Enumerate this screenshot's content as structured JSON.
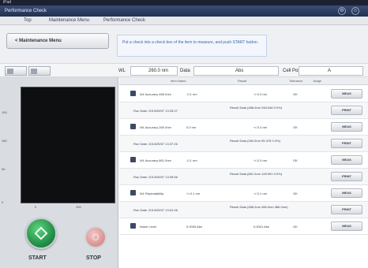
{
  "statusbar": {
    "carrier": "iPad",
    "time": "",
    "battery": ""
  },
  "titlebar": {
    "title": "Performance Check"
  },
  "tabs": [
    "Top",
    "Maintenance Menu",
    "Performance Check"
  ],
  "nav": {
    "back_label": "< Maintenance Menu",
    "instruction": "Put a check into a check box of the item to measure, and push START button."
  },
  "controls": {
    "wl_label": "WL",
    "wl_value": "260.0 nm",
    "data_label": "Data",
    "data_value": "Abs",
    "cell_label": "Cell Pos.",
    "cell_value": "A"
  },
  "plot": {
    "y_ticks": [
      "100",
      "150",
      "50",
      "0"
    ],
    "x_ticks": [
      "0",
      "100"
    ]
  },
  "actions": {
    "start": "START",
    "stop": "STOP"
  },
  "table": {
    "headers": [
      "Item Name",
      "Result",
      "Tolerance",
      "Judge"
    ],
    "measure_label": "MEAS",
    "print_label": "PRINT",
    "rows": [
      {
        "type": "item",
        "name": "WL Accuracy 486.0nm",
        "result": "-0.1 nm",
        "tolerance": "+/-0.3 nm",
        "judge": "OK"
      },
      {
        "type": "run",
        "date": "Run Date: 2013/05/07 13:33:07",
        "result": "Result Data (486.0nm 248.548 0.0%)"
      },
      {
        "type": "item",
        "name": "WL Accuracy 260.0nm",
        "result": "0.0 nm",
        "tolerance": "+/-0.3 nm",
        "judge": "OK"
      },
      {
        "type": "run",
        "date": "Run Date: 2013/05/07 13:37:26",
        "result": "Result Data (260.0nm 95.478 0.0%)"
      },
      {
        "type": "item",
        "name": "WL Accuracy 861.0nm",
        "result": "-0.1 nm",
        "tolerance": "+/-0.3 nm",
        "judge": "OK"
      },
      {
        "type": "run",
        "date": "Run Date: 2013/05/07 13:39:56",
        "result": "Result Data (861.0nm 128.951 0.0%)"
      },
      {
        "type": "item",
        "name": "WL Repeatability",
        "result": "+/-0.1 nm",
        "tolerance": "+/-0.1 nm",
        "judge": "OK"
      },
      {
        "type": "run",
        "date": "Run Date: 2013/05/07 13:51:06",
        "result": "Result Data (486.0nm 486.0nm 486.0nm)"
      },
      {
        "type": "item",
        "name": "Noise Level",
        "result": "0.0005 Abs",
        "tolerance": "0.0001 Abs",
        "judge": "OK"
      }
    ]
  },
  "colors": {
    "title_bg": "#22304f",
    "start_green": "#1f8c43",
    "stop_red": "#d98f8f",
    "accent_blue": "#3c66a8"
  }
}
